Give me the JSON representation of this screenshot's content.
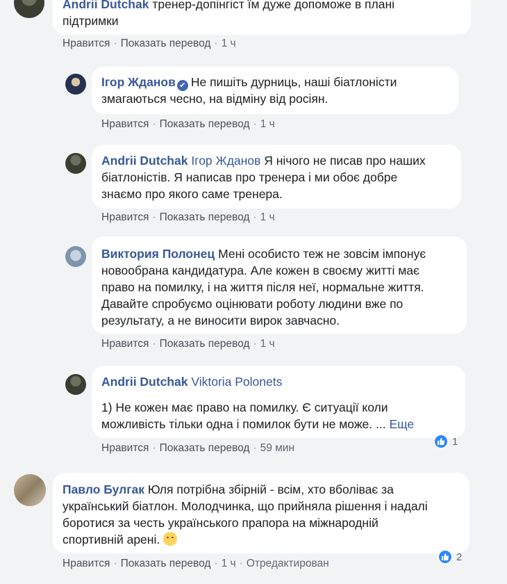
{
  "comments": [
    {
      "author": "Andrii Dutchak",
      "lines": [
        "тренер-допінгіст їм дуже допоможе в плані",
        "підтримки"
      ],
      "actions": {
        "like": "Нравится",
        "translate": "Показать перевод",
        "time": "1 ч"
      }
    },
    {
      "author": "Ігор Жданов",
      "verified": true,
      "lines": [
        "Не пишіть дурниць, наші біатлоністи",
        "змагаються чесно, на відміну від росіян."
      ],
      "actions": {
        "like": "Нравится",
        "translate": "Показать перевод",
        "time": "1 ч"
      }
    },
    {
      "author": "Andrii Dutchak",
      "mention": "Ігор Жданов",
      "lines": [
        "Я нічого не писав про наших",
        "біатлоністів. Я написав про тренера і ми обоє добре",
        "знаємо про якого саме тренера."
      ],
      "actions": {
        "like": "Нравится",
        "translate": "Показать перевод",
        "time": "1 ч"
      }
    },
    {
      "author": "Виктория Полонец",
      "lines": [
        "Мені особисто теж не зовсім імпонує",
        "новообрана кандидатура. Але кожен в своєму житті має",
        "право на помилку, і на життя після неї, нормальне життя.",
        "Давайте спробуємо оцінювати роботу людини вже по",
        "результату, а не виносити вирок завчасно."
      ],
      "actions": {
        "like": "Нравится",
        "translate": "Показать перевод",
        "time": "1 ч"
      }
    },
    {
      "author": "Andrii Dutchak",
      "mention": "Viktoria Polonets",
      "lines": [
        "1) Не кожен має право на помилку. Є ситуації коли",
        "можливість тільки одна і помилок бути не може. ..."
      ],
      "more": "Еще",
      "actions": {
        "like": "Нравится",
        "translate": "Показать перевод",
        "time": "59 мин"
      },
      "reaction_count": "1"
    },
    {
      "author": "Павло Булгак",
      "lines": [
        "Юля потрібна збірній - всім, хто вболіває за",
        "український біатлон. Молодчинка, що прийняла рішення і надалі",
        "боротися за честь українського прапора на міжнародній",
        "спортивній арені."
      ],
      "emoji": "hugging-face",
      "actions": {
        "like": "Нравится",
        "translate": "Показать перевод",
        "time": "1 ч",
        "edited": "Отредактирован"
      },
      "reaction_count": "2"
    }
  ]
}
